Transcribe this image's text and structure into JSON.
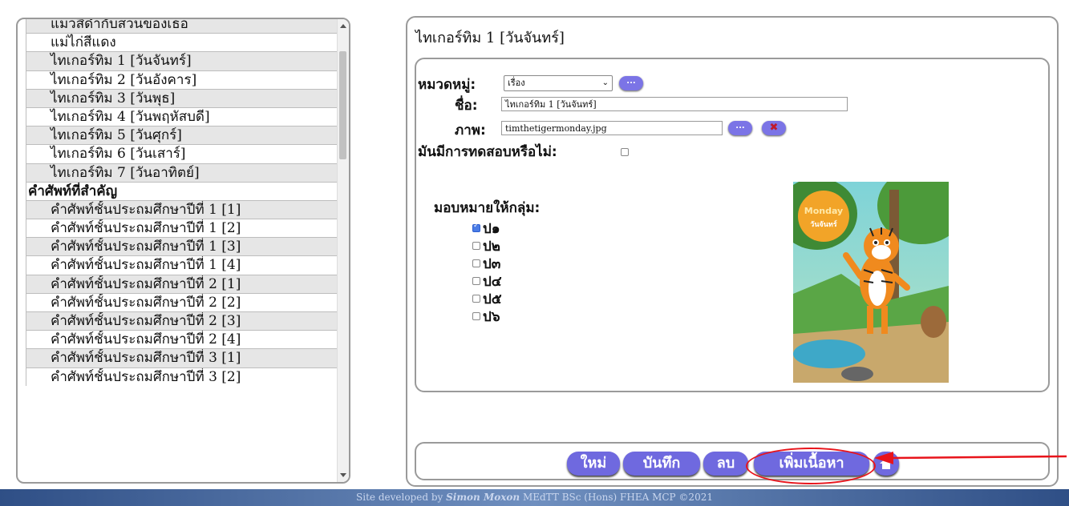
{
  "left_list": {
    "rows": [
      {
        "label": "แมวสีดำกับสวนของเธอ",
        "kind": "item",
        "shade": "alt"
      },
      {
        "label": "แม่ไก่สีแดง",
        "kind": "item",
        "shade": "white"
      },
      {
        "label": "ไทเกอร์ทิม 1 [วันจันทร์]",
        "kind": "item",
        "shade": "alt"
      },
      {
        "label": "ไทเกอร์ทิม 2 [วันอังคาร]",
        "kind": "item",
        "shade": "white"
      },
      {
        "label": "ไทเกอร์ทิม 3 [วันพุธ]",
        "kind": "item",
        "shade": "alt"
      },
      {
        "label": "ไทเกอร์ทิม 4 [วันพฤหัสบดี]",
        "kind": "item",
        "shade": "white"
      },
      {
        "label": "ไทเกอร์ทิม 5 [วันศุกร์]",
        "kind": "item",
        "shade": "alt"
      },
      {
        "label": "ไทเกอร์ทิม 6 [วันเสาร์]",
        "kind": "item",
        "shade": "white"
      },
      {
        "label": "ไทเกอร์ทิม 7 [วันอาทิตย์]",
        "kind": "item",
        "shade": "alt"
      },
      {
        "label": "คำศัพท์ที่สำคัญ",
        "kind": "category",
        "shade": "white"
      },
      {
        "label": "คำศัพท์ชั้นประถมศึกษาปีที่ 1 [1]",
        "kind": "item",
        "shade": "alt"
      },
      {
        "label": "คำศัพท์ชั้นประถมศึกษาปีที่ 1 [2]",
        "kind": "item",
        "shade": "white"
      },
      {
        "label": "คำศัพท์ชั้นประถมศึกษาปีที่ 1 [3]",
        "kind": "item",
        "shade": "alt"
      },
      {
        "label": "คำศัพท์ชั้นประถมศึกษาปีที่ 1 [4]",
        "kind": "item",
        "shade": "white"
      },
      {
        "label": "คำศัพท์ชั้นประถมศึกษาปีที่ 2 [1]",
        "kind": "item",
        "shade": "alt"
      },
      {
        "label": "คำศัพท์ชั้นประถมศึกษาปีที่ 2 [2]",
        "kind": "item",
        "shade": "white"
      },
      {
        "label": "คำศัพท์ชั้นประถมศึกษาปีที่ 2 [3]",
        "kind": "item",
        "shade": "alt"
      },
      {
        "label": "คำศัพท์ชั้นประถมศึกษาปีที่ 2 [4]",
        "kind": "item",
        "shade": "white"
      },
      {
        "label": "คำศัพท์ชั้นประถมศึกษาปีที่ 3 [1]",
        "kind": "item",
        "shade": "alt"
      },
      {
        "label": "คำศัพท์ชั้นประถมศึกษาปีที่ 3 [2]",
        "kind": "item",
        "shade": "white"
      }
    ]
  },
  "editor": {
    "title": "ไทเกอร์ทิม 1 [วันจันทร์]",
    "category_label": "หมวดหมู่:",
    "category_value": "เรื่อง",
    "name_label": "ชื่อ:",
    "name_value": "ไทเกอร์ทิม 1 [วันจันทร์]",
    "image_label": "ภาพ:",
    "image_value": "timthetigermonday.jpg",
    "browse_label": "...",
    "clear_label": "✖",
    "test_label": "มันมีการทดสอบหรือไม่:",
    "test_checked": false,
    "assign_label": "มอบหมายให้กลุ่ม:",
    "groups": [
      {
        "label": "ป๑",
        "checked": true
      },
      {
        "label": "ป๒",
        "checked": false
      },
      {
        "label": "ป๓",
        "checked": false
      },
      {
        "label": "ป๔",
        "checked": false
      },
      {
        "label": "ป๕",
        "checked": false
      },
      {
        "label": "ป๖",
        "checked": false
      }
    ],
    "image_caption_en": "Monday",
    "image_caption_th": "วันจันทร์"
  },
  "buttons": {
    "new": "ใหม่",
    "save": "บันทึก",
    "delete": "ลบ",
    "add_content": "เพิ่มเนื้อหา",
    "home_icon": "home-icon"
  },
  "footer": {
    "prefix": "Site developed by",
    "author": "Simon Moxon",
    "credentials": "MEdTT  BSc (Hons)  FHEA  MCP  ©2021"
  },
  "colors": {
    "button_purple": "#6f69df",
    "annotation_red": "#e8141b",
    "footer_blue": "#2f4f86"
  }
}
